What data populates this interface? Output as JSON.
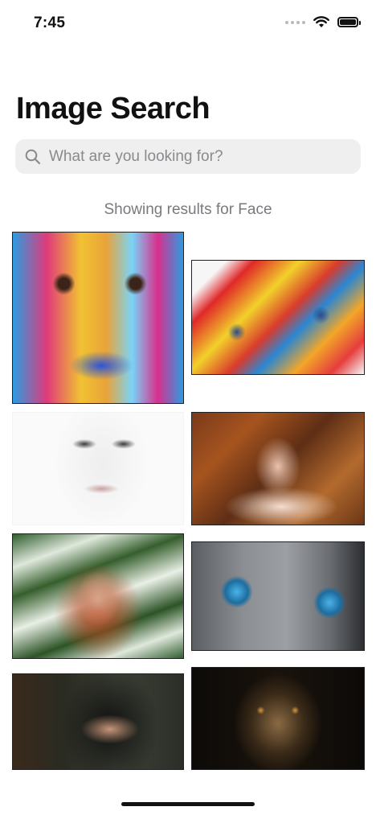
{
  "status_bar": {
    "time": "7:45",
    "icons": [
      "signal-dots-icon",
      "wifi-icon",
      "battery-icon"
    ]
  },
  "header": {
    "title": "Image Search"
  },
  "search": {
    "placeholder": "What are you looking for?",
    "value": "",
    "icon": "magnifying-glass-icon"
  },
  "results": {
    "caption": "Showing results for Face",
    "images": [
      {
        "name": "colorful-painted-face-with-hands"
      },
      {
        "name": "face-with-paint-covered-hand"
      },
      {
        "name": "black-and-white-woman-portrait"
      },
      {
        "name": "woman-lying-in-autumn-leaves"
      },
      {
        "name": "woman-with-white-flowers"
      },
      {
        "name": "cat-with-blue-eyes"
      },
      {
        "name": "woman-wearing-hijab-and-veil"
      },
      {
        "name": "lion-face"
      }
    ]
  },
  "colors": {
    "background": "#ffffff",
    "search_bar_bg": "#efeff0",
    "caption_text": "#7a7a7e",
    "title_text": "#111111"
  }
}
